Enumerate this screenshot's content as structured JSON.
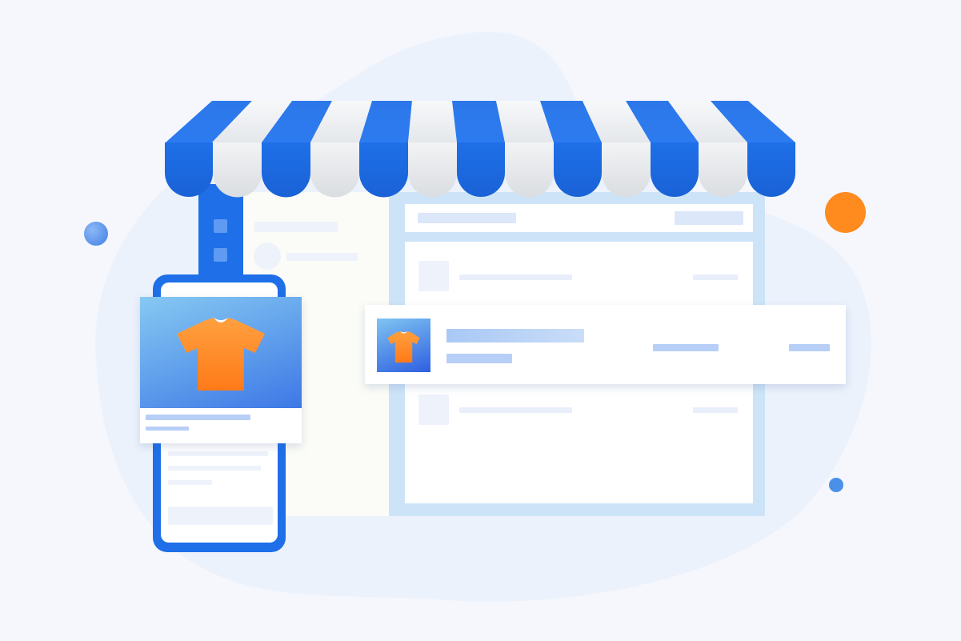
{
  "illustration": {
    "subject": "online-store",
    "icons": [
      "storefront-awning-icon",
      "tshirt-icon",
      "tshirt-icon"
    ],
    "colors": {
      "background": "#F5F7FC",
      "blob": "#ECF2FC",
      "awning_blue": "#1E6FE8",
      "awning_white": "#EEF0F3",
      "accent_orange": "#FF8A1E",
      "placeholder": "#EEF2FB",
      "placeholder_strong": "#B7CFF7"
    }
  }
}
